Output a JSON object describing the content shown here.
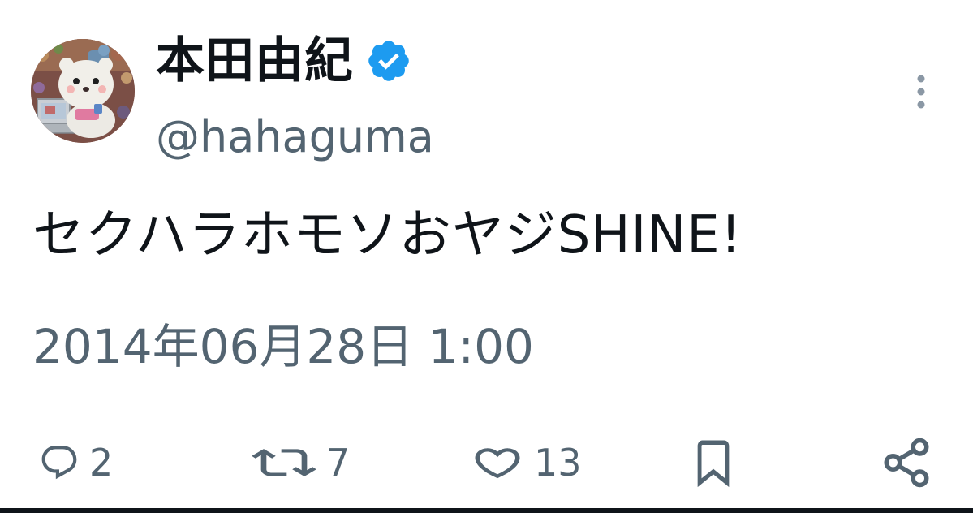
{
  "author": {
    "display_name": "本田由紀",
    "handle": "@hahaguma",
    "verified": true,
    "avatar": "plush-bear-avatar"
  },
  "tweet": {
    "text": "セクハラホモソおヤジSHINE!",
    "timestamp": "2014年06月28日 1:00"
  },
  "actions": {
    "reply": {
      "icon": "reply-bubble-icon",
      "count": "2"
    },
    "retweet": {
      "icon": "retweet-icon",
      "count": "7"
    },
    "like": {
      "icon": "heart-icon",
      "count": "13"
    },
    "bookmark": {
      "icon": "bookmark-icon"
    },
    "share": {
      "icon": "share-icon"
    }
  },
  "colors": {
    "text_primary": "#0f1419",
    "text_secondary": "#536471",
    "verified_blue": "#1d9bf0"
  }
}
